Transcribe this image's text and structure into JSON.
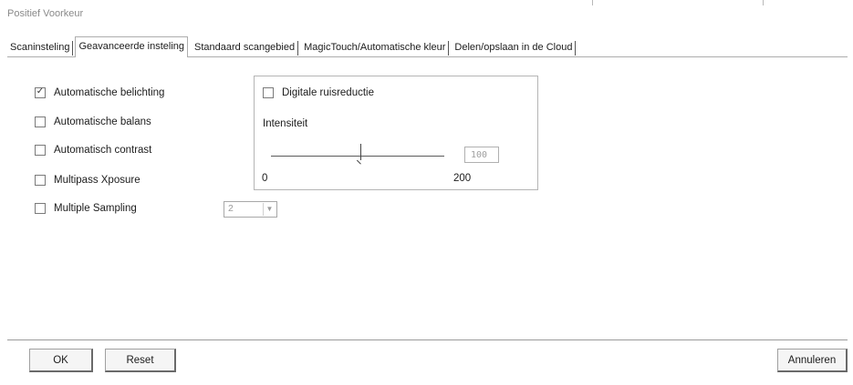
{
  "window": {
    "title": "Positief Voorkeur"
  },
  "tabs": [
    {
      "label": "Scaninsteling",
      "active": false
    },
    {
      "label": "Geavanceerde insteling",
      "active": true
    },
    {
      "label": "Standaard scangebied",
      "active": false
    },
    {
      "label": "MagicTouch/Automatische kleur",
      "active": false
    },
    {
      "label": "Delen/opslaan in de Cloud",
      "active": false
    }
  ],
  "options": [
    {
      "label": "Automatische belichting",
      "checked": true
    },
    {
      "label": "Automatische balans",
      "checked": false
    },
    {
      "label": "Automatisch contrast",
      "checked": false
    },
    {
      "label": "Multipass Xposure",
      "checked": false
    },
    {
      "label": "Multiple Sampling",
      "checked": false
    }
  ],
  "multiple_sampling": {
    "selected_value": "2"
  },
  "noise_reduction": {
    "label": "Digitale ruisreductie",
    "checked": false,
    "intensity_label": "Intensiteit",
    "slider_min_label": "0",
    "slider_max_label": "200",
    "value": "100"
  },
  "buttons": {
    "ok": "OK",
    "reset": "Reset",
    "cancel": "Annuleren"
  }
}
